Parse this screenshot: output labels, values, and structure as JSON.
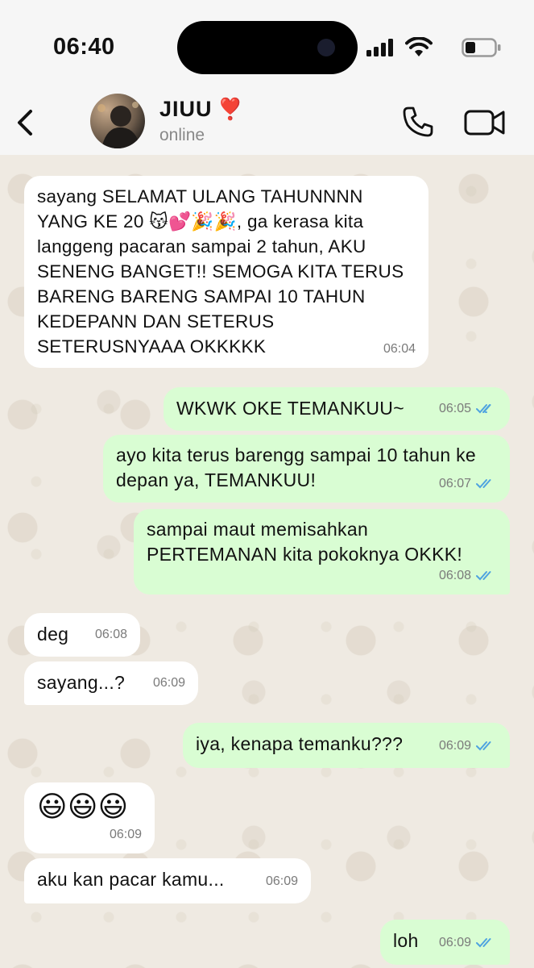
{
  "status_bar": {
    "time": "06:40"
  },
  "header": {
    "contact_name": "JIUU",
    "contact_emoji": "❣️",
    "contact_status": "online"
  },
  "colors": {
    "incoming_bubble": "#ffffff",
    "outgoing_bubble": "#d9fdd3",
    "read_check": "#4fa3e0",
    "chat_background": "#efeae2"
  },
  "messages": [
    {
      "direction": "in",
      "text": "sayang SELAMAT ULANG TAHUNNNN YANG KE 20 😽💕🎉🎉, ga kerasa kita langgeng pacaran sampai 2 tahun, AKU SENENG BANGET!! SEMOGA KITA TERUS BARENG BARENG SAMPAI 10 TAHUN KEDEPANN DAN SETERUS SETERUSNYAAA OKKKKK",
      "time": "06:04"
    },
    {
      "direction": "out",
      "text": "WKWK OKE TEMANKUU~",
      "time": "06:05",
      "read": true
    },
    {
      "direction": "out",
      "text": "ayo kita terus barengg sampai 10 tahun ke depan ya, TEMANKUU!",
      "time": "06:07",
      "read": true
    },
    {
      "direction": "out",
      "text": "sampai maut memisahkan PERTEMANAN kita pokoknya OKKK!",
      "time": "06:08",
      "read": true
    },
    {
      "direction": "in",
      "text": "deg",
      "time": "06:08"
    },
    {
      "direction": "in",
      "text": "sayang...?",
      "time": "06:09"
    },
    {
      "direction": "out",
      "text": "iya, kenapa temanku???",
      "time": "06:09",
      "read": true
    },
    {
      "direction": "in",
      "text": "😃😃😃",
      "time": "06:09"
    },
    {
      "direction": "in",
      "text": "aku kan pacar kamu...",
      "time": "06:09"
    },
    {
      "direction": "out",
      "text": "loh",
      "time": "06:09",
      "read": true
    }
  ]
}
